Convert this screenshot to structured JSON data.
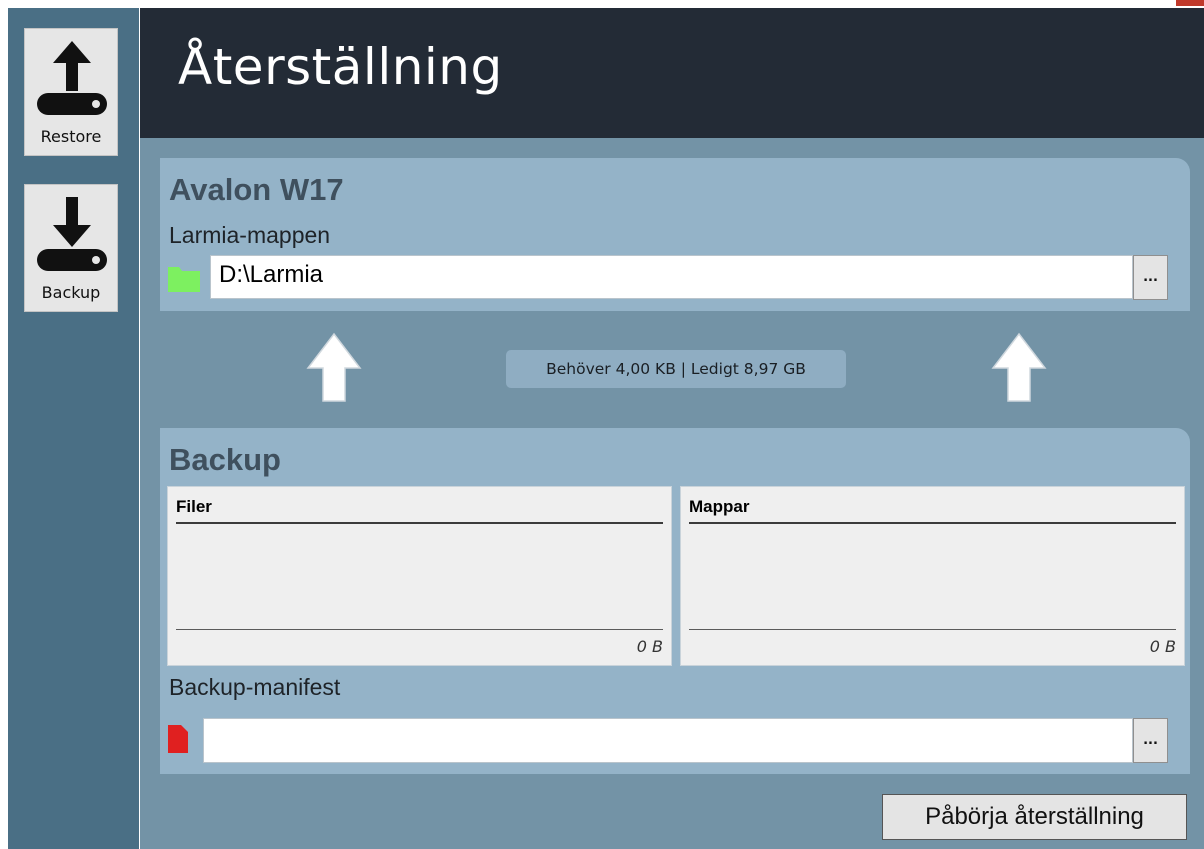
{
  "header": {
    "title": "Återställning"
  },
  "sidebar": {
    "items": [
      {
        "label": "Restore",
        "icon": "upload-drive-icon"
      },
      {
        "label": "Backup",
        "icon": "download-drive-icon"
      }
    ]
  },
  "target": {
    "title": "Avalon W17",
    "folder_label": "Larmia-mappen",
    "folder_value": "D:\\Larmia",
    "browse_label": "...",
    "folder_status_color": "#7df060"
  },
  "transfer": {
    "space_info": "Behöver 4,00 KB | Ledigt 8,97 GB"
  },
  "backup": {
    "title": "Backup",
    "files": {
      "header": "Filer",
      "size": "0 B"
    },
    "folders": {
      "header": "Mappar",
      "size": "0 B"
    },
    "manifest_label": "Backup-manifest",
    "manifest_value": "",
    "browse_label": "...",
    "manifest_status_color": "#e02020"
  },
  "actions": {
    "start_label": "Påbörja återställning"
  },
  "colors": {
    "header_bg": "#232b36",
    "sidebar_bg": "#4a6f85",
    "main_bg": "#7393a6",
    "panel_bg": "#94b3c8"
  }
}
